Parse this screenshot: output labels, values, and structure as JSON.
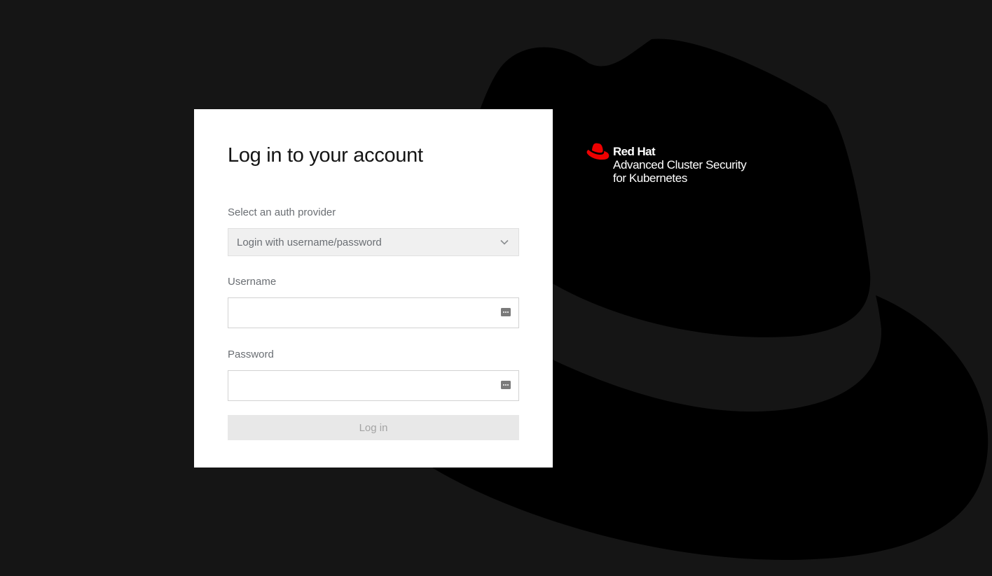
{
  "login": {
    "title": "Log in to your account",
    "auth_provider_label": "Select an auth provider",
    "auth_provider_selected": "Login with username/password",
    "username_label": "Username",
    "username_value": "",
    "password_label": "Password",
    "password_value": "",
    "login_button": "Log in"
  },
  "brand": {
    "company": "Red Hat",
    "product_line1": "Advanced Cluster Security",
    "product_line2": "for Kubernetes"
  },
  "icons": {
    "logo": "red-hat-fedora-icon",
    "select_chevron": "chevron-down-icon",
    "autofill": "password-manager-icon"
  },
  "colors": {
    "background": "#151515",
    "hat_silhouette": "#000000",
    "card": "#ffffff",
    "brand_red": "#ee0000",
    "disabled_button": "#e8e8e8"
  }
}
